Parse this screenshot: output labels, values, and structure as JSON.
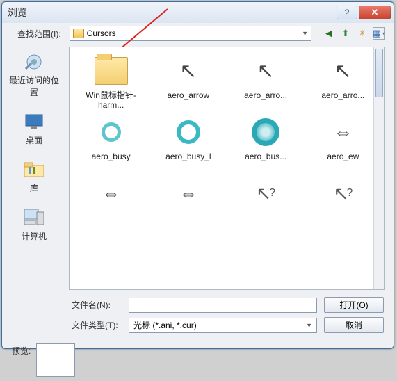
{
  "window": {
    "title": "浏览"
  },
  "toolbar": {
    "look_in_label": "查找范围(I):",
    "location": "Cursors"
  },
  "places": [
    {
      "label": "最近访问的位置",
      "icon": "recent"
    },
    {
      "label": "桌面",
      "icon": "desktop"
    },
    {
      "label": "库",
      "icon": "libraries"
    },
    {
      "label": "计算机",
      "icon": "computer"
    }
  ],
  "files": [
    {
      "name": "Win鼠标指针-harm...",
      "type": "folder"
    },
    {
      "name": "aero_arrow",
      "type": "cursor-arrow"
    },
    {
      "name": "aero_arro...",
      "type": "cursor-arrow"
    },
    {
      "name": "aero_arro...",
      "type": "cursor-arrow"
    },
    {
      "name": "aero_busy",
      "type": "busy-s"
    },
    {
      "name": "aero_busy_l",
      "type": "busy-l"
    },
    {
      "name": "aero_bus...",
      "type": "busy-xl"
    },
    {
      "name": "aero_ew",
      "type": "ew"
    },
    {
      "name": "",
      "type": "ew"
    },
    {
      "name": "",
      "type": "ew"
    },
    {
      "name": "",
      "type": "help"
    },
    {
      "name": "",
      "type": "help"
    }
  ],
  "bottom": {
    "filename_label": "文件名(N):",
    "filename_value": "",
    "filetype_label": "文件类型(T):",
    "filetype_value": "光标 (*.ani, *.cur)",
    "open_label": "打开(O)",
    "cancel_label": "取消"
  },
  "preview": {
    "label": "预览:"
  }
}
